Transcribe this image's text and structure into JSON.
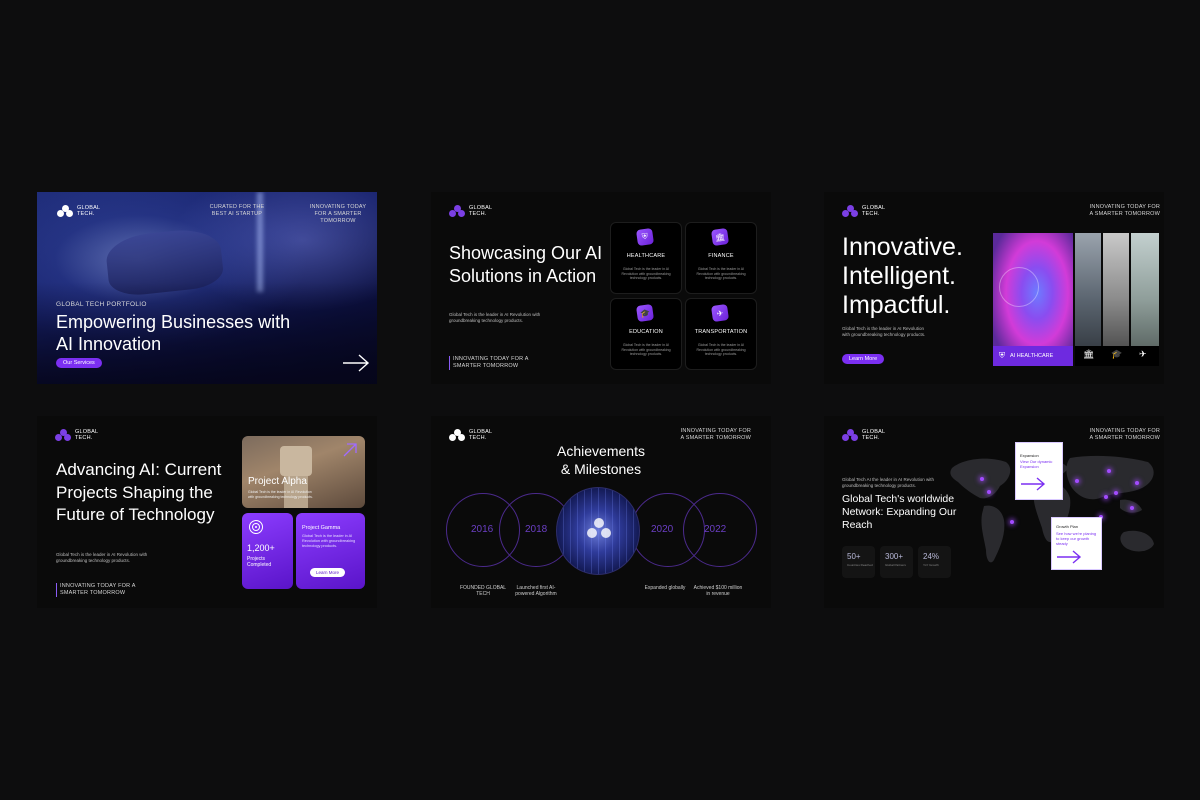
{
  "brand": {
    "name": "GLOBAL TECH."
  },
  "common": {
    "tagline": "INNOVATING TODAY FOR A SMARTER TOMORROW",
    "body": "Global Tech is the leader in AI Revolution with groundbreaking technology products."
  },
  "slide1": {
    "curated": "CURATED FOR THE BEST AI STARTUP",
    "tagline": "INNOVATING TODAY FOR A SMARTER TOMORROW",
    "kicker": "GLOBAL TECH PORTFOLIO",
    "title": "Empowering Businesses with AI Innovation",
    "button": "Our Services"
  },
  "slide2": {
    "title": "Showcasing Our AI Solutions in Action",
    "body": "Global Tech is the leader in AI Revolution with groundbreaking technology products.",
    "cards": [
      {
        "title": "HEALTHCARE",
        "icon": "shield-icon",
        "desc": "Global Tech is the leader in AI Revolution with groundbreaking technology products."
      },
      {
        "title": "FINANCE",
        "icon": "bank-icon",
        "desc": "Global Tech is the leader in AI Revolution with groundbreaking technology products."
      },
      {
        "title": "EDUCATION",
        "icon": "graduation-cap-icon",
        "desc": "Global Tech is the leader in AI Revolution with groundbreaking technology products."
      },
      {
        "title": "TRANSPORTATION",
        "icon": "airplane-icon",
        "desc": "Global Tech is the leader in AI Revolution with groundbreaking technology products."
      }
    ]
  },
  "slide3": {
    "title_l1": "Innovative.",
    "title_l2": "Intelligent.",
    "title_l3": "Impactful.",
    "body": "Global Tech is the leader in AI Revolution with groundbreaking technology products.",
    "button": "Learn More",
    "badge": "AI HEALTHCARE"
  },
  "slide4": {
    "title": "Advancing AI: Current Projects Shaping the Future of Technology",
    "body": "Global Tech is the leader in AI Revolution with groundbreaking technology products.",
    "alpha_title": "Project Alpha",
    "alpha_desc": "Global Tech is the leader in AI Revolution with groundbreaking technology products.",
    "stat_number": "1,200+",
    "stat_label": "Projects Completed",
    "gamma_title": "Project Gamma",
    "gamma_desc": "Global Tech is the leader in AI Revolution with groundbreaking technology products.",
    "gamma_button": "Learn More"
  },
  "slide5": {
    "title_l1": "Achievements",
    "title_l2": "& Milestones",
    "years": [
      "2016",
      "2018",
      "2020",
      "2022"
    ],
    "milestones": [
      "FOUNDED GLOBAL TECH",
      "Launched first AI-powered Algorithm",
      "Expanded globally",
      "Achieved $100 million in revenue"
    ]
  },
  "slide6": {
    "body": "Global Tech AI the leader in AI Revolution with groundbreaking technology products.",
    "title": "Global Tech's worldwide Network: Expanding Our Reach",
    "stats": [
      {
        "value": "50+",
        "label": "Countries Reached"
      },
      {
        "value": "300+",
        "label": "Global Partners"
      },
      {
        "value": "24%",
        "label": "YoY Growth"
      }
    ],
    "card1_title": "Expansion",
    "card1_desc": "View Our dynamic Expansion",
    "card2_title": "Growth Plan",
    "card2_desc": "See how we're planing to keep our growth steady"
  },
  "colors": {
    "accent": "#7b2ff2",
    "background": "#0d0d0e",
    "slide": "#0a0a0a"
  }
}
